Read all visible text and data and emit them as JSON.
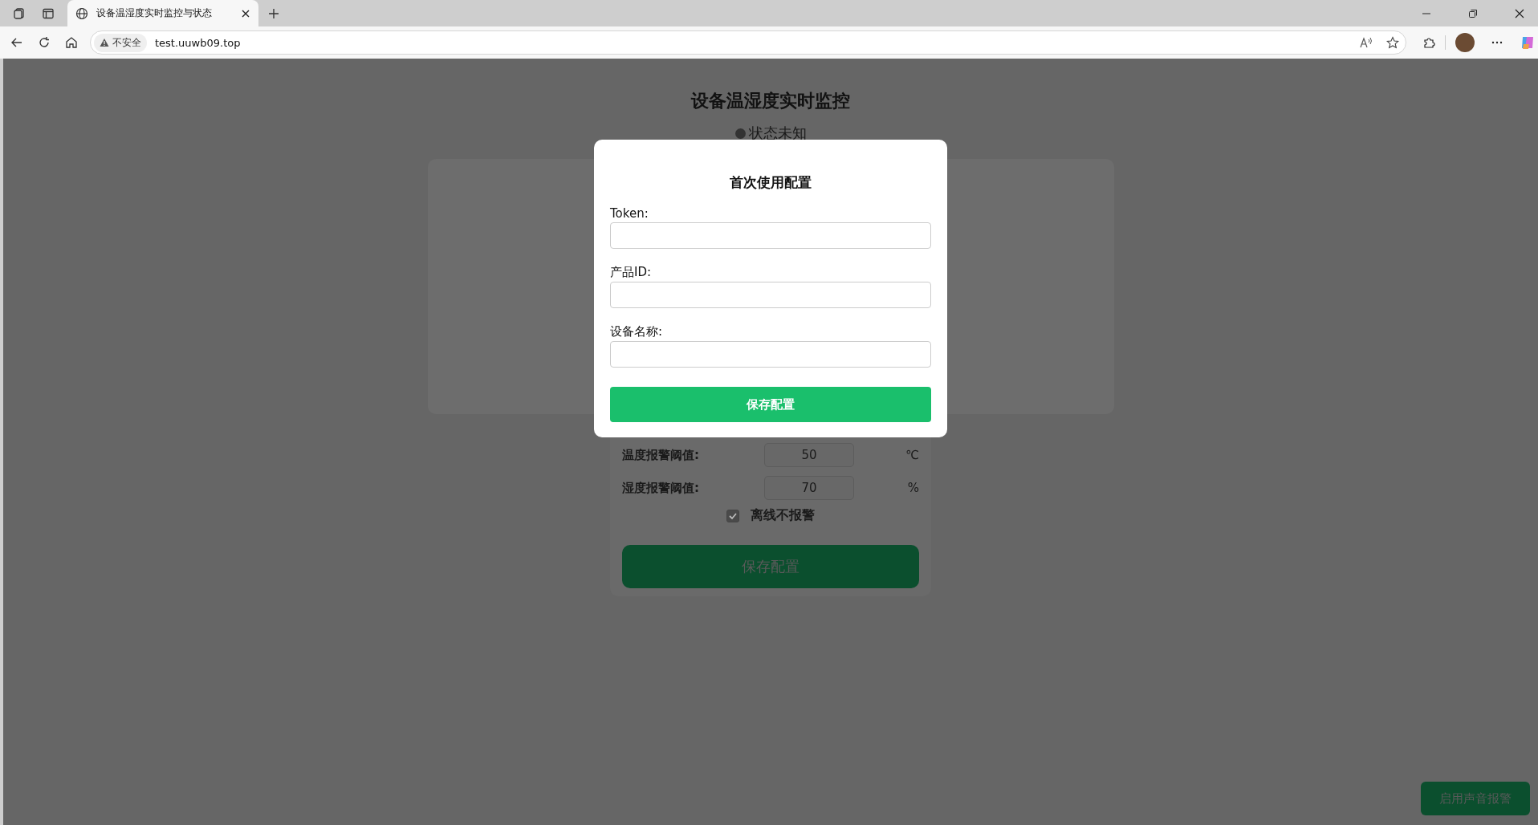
{
  "browser": {
    "tab_title": "设备温湿度实时监控与状态",
    "security_label": "不安全",
    "url": "test.uuwb09.top"
  },
  "page": {
    "title": "设备温湿度实时监控",
    "status": "状态未知"
  },
  "settings": {
    "thresholds": [
      {
        "label": "温度报警阈值:",
        "value": "50",
        "unit": "℃"
      },
      {
        "label": "湿度报警阈值:",
        "value": "70",
        "unit": "%"
      }
    ],
    "offline_alarm": {
      "label": "离线不报警",
      "checked": true
    },
    "save_button": "保存配置"
  },
  "sound_alarm_button": "启用声音报警",
  "modal": {
    "title": "首次使用配置",
    "fields": [
      {
        "label": "Token:"
      },
      {
        "label": "产品ID:"
      },
      {
        "label": "设备名称:"
      }
    ],
    "save_button": "保存配置"
  }
}
